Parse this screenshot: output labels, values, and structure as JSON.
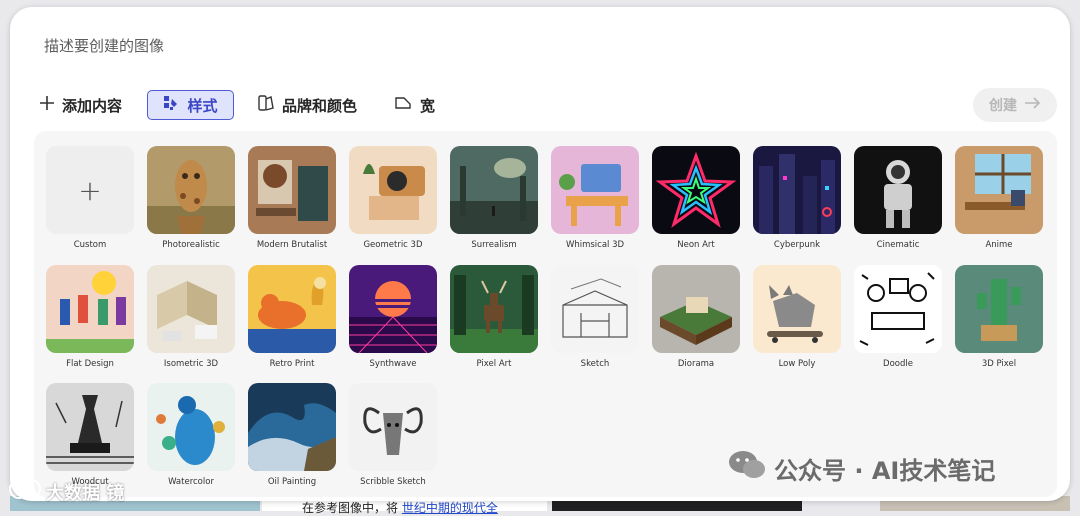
{
  "prompt": {
    "placeholder": "描述要创建的图像"
  },
  "toolbar": {
    "add_label": "添加内容",
    "style_label": "样式",
    "brand_label": "品牌和颜色",
    "aspect_label": "宽",
    "create_label": "创建"
  },
  "styles": [
    {
      "label": "Custom",
      "icon": "plus-icon"
    },
    {
      "label": "Photorealistic"
    },
    {
      "label": "Modern Brutalist"
    },
    {
      "label": "Geometric 3D"
    },
    {
      "label": "Surrealism"
    },
    {
      "label": "Whimsical 3D"
    },
    {
      "label": "Neon Art"
    },
    {
      "label": "Cyberpunk"
    },
    {
      "label": "Cinematic"
    },
    {
      "label": "Anime"
    },
    {
      "label": "Flat Design"
    },
    {
      "label": "Isometric 3D"
    },
    {
      "label": "Retro Print"
    },
    {
      "label": "Synthwave"
    },
    {
      "label": "Pixel Art"
    },
    {
      "label": "Sketch"
    },
    {
      "label": "Diorama"
    },
    {
      "label": "Low Poly"
    },
    {
      "label": "Doodle"
    },
    {
      "label": "3D Pixel"
    },
    {
      "label": "Woodcut"
    },
    {
      "label": "Watercolor"
    },
    {
      "label": "Oil Painting"
    },
    {
      "label": "Scribble Sketch"
    }
  ],
  "background": {
    "text_prefix": "在参考图像中，将",
    "text_link": "世纪中期的现代全"
  },
  "watermarks": {
    "wechat": "公众号 · AI技术笔记",
    "corner": "大数据 镜"
  },
  "colors": {
    "accent": "#4f5bd5",
    "accent_bg": "#dfe3fb",
    "disabled": "#b8b8b8"
  }
}
